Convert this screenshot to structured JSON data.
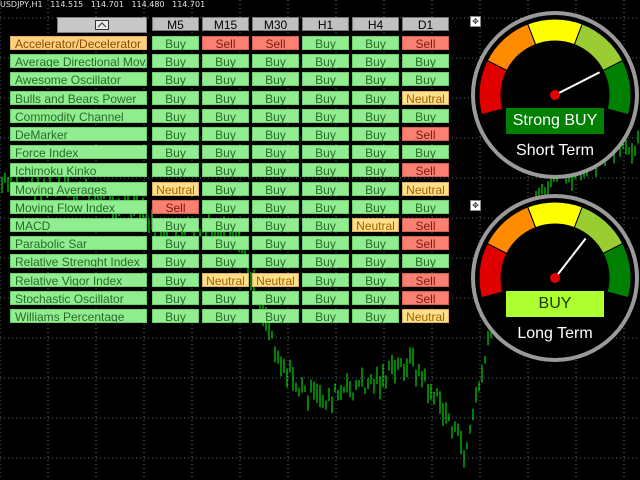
{
  "window": {
    "symbol_tf": "USDJPY,H1",
    "ohlc": [
      "114.515",
      "114.701",
      "114.480",
      "114.701"
    ]
  },
  "panel": {
    "toggle_icon": "minimize-window-icon",
    "timeframes": [
      "M5",
      "M15",
      "M30",
      "H1",
      "H4",
      "D1"
    ],
    "rows": [
      {
        "name": "Accelerator/Decelerator",
        "highlight": true,
        "signals": [
          "Buy",
          "Sell",
          "Sell",
          "Buy",
          "Buy",
          "Sell"
        ]
      },
      {
        "name": "Average Directional Mov.",
        "highlight": false,
        "signals": [
          "Buy",
          "Buy",
          "Buy",
          "Buy",
          "Buy",
          "Buy"
        ]
      },
      {
        "name": "Awesome Oscillator",
        "highlight": false,
        "signals": [
          "Buy",
          "Buy",
          "Buy",
          "Buy",
          "Buy",
          "Buy"
        ]
      },
      {
        "name": "Bulls and Bears Power",
        "highlight": false,
        "signals": [
          "Buy",
          "Buy",
          "Buy",
          "Buy",
          "Buy",
          "Neutral"
        ]
      },
      {
        "name": "Commodity Channel",
        "highlight": false,
        "signals": [
          "Buy",
          "Buy",
          "Buy",
          "Buy",
          "Buy",
          "Buy"
        ]
      },
      {
        "name": "DeMarker",
        "highlight": false,
        "signals": [
          "Buy",
          "Buy",
          "Buy",
          "Buy",
          "Buy",
          "Sell"
        ]
      },
      {
        "name": "Force Index",
        "highlight": false,
        "signals": [
          "Buy",
          "Buy",
          "Buy",
          "Buy",
          "Buy",
          "Buy"
        ]
      },
      {
        "name": "Ichimoku Kinko",
        "highlight": false,
        "signals": [
          "Buy",
          "Buy",
          "Buy",
          "Buy",
          "Buy",
          "Sell"
        ]
      },
      {
        "name": "Moving Averages",
        "highlight": false,
        "signals": [
          "Neutral",
          "Buy",
          "Buy",
          "Buy",
          "Buy",
          "Neutral"
        ]
      },
      {
        "name": "Moving Flow Index",
        "highlight": false,
        "signals": [
          "Sell",
          "Buy",
          "Buy",
          "Buy",
          "Buy",
          "Buy"
        ]
      },
      {
        "name": "MACD",
        "highlight": false,
        "signals": [
          "Buy",
          "Buy",
          "Buy",
          "Buy",
          "Neutral",
          "Sell"
        ]
      },
      {
        "name": "Parabolic Sar",
        "highlight": false,
        "signals": [
          "Buy",
          "Buy",
          "Buy",
          "Buy",
          "Buy",
          "Sell"
        ]
      },
      {
        "name": "Relative Strenght Index",
        "highlight": false,
        "signals": [
          "Buy",
          "Buy",
          "Buy",
          "Buy",
          "Buy",
          "Buy"
        ]
      },
      {
        "name": "Relative Vigor Index",
        "highlight": false,
        "signals": [
          "Buy",
          "Neutral",
          "Neutral",
          "Buy",
          "Buy",
          "Sell"
        ]
      },
      {
        "name": "Stochastic Oscillator",
        "highlight": false,
        "signals": [
          "Buy",
          "Buy",
          "Buy",
          "Buy",
          "Buy",
          "Sell"
        ]
      },
      {
        "name": "Williams Percentage",
        "highlight": false,
        "signals": [
          "Buy",
          "Buy",
          "Buy",
          "Buy",
          "Buy",
          "Neutral"
        ]
      }
    ]
  },
  "gauges": [
    {
      "signal": "Strong BUY",
      "term": "Short Term",
      "needle_level": 0.8,
      "signal_bg": "#008000",
      "signal_fg": "#ffffff"
    },
    {
      "signal": "BUY",
      "term": "Long Term",
      "needle_level": 0.68,
      "signal_bg": "#adff2f",
      "signal_fg": "#1a3a00"
    }
  ],
  "colors": {
    "buy": "#90ee90",
    "sell": "#fa8072",
    "neutral": "#ffe08a",
    "gauge_red": "#e00000",
    "gauge_orange": "#ff8c00",
    "gauge_yellow": "#ffff00",
    "gauge_lime": "#9acd32",
    "gauge_green": "#008000",
    "candle": "#00ff00",
    "grid": "#5a6a78"
  },
  "icons": {
    "pin": "drag-handle-icon"
  }
}
